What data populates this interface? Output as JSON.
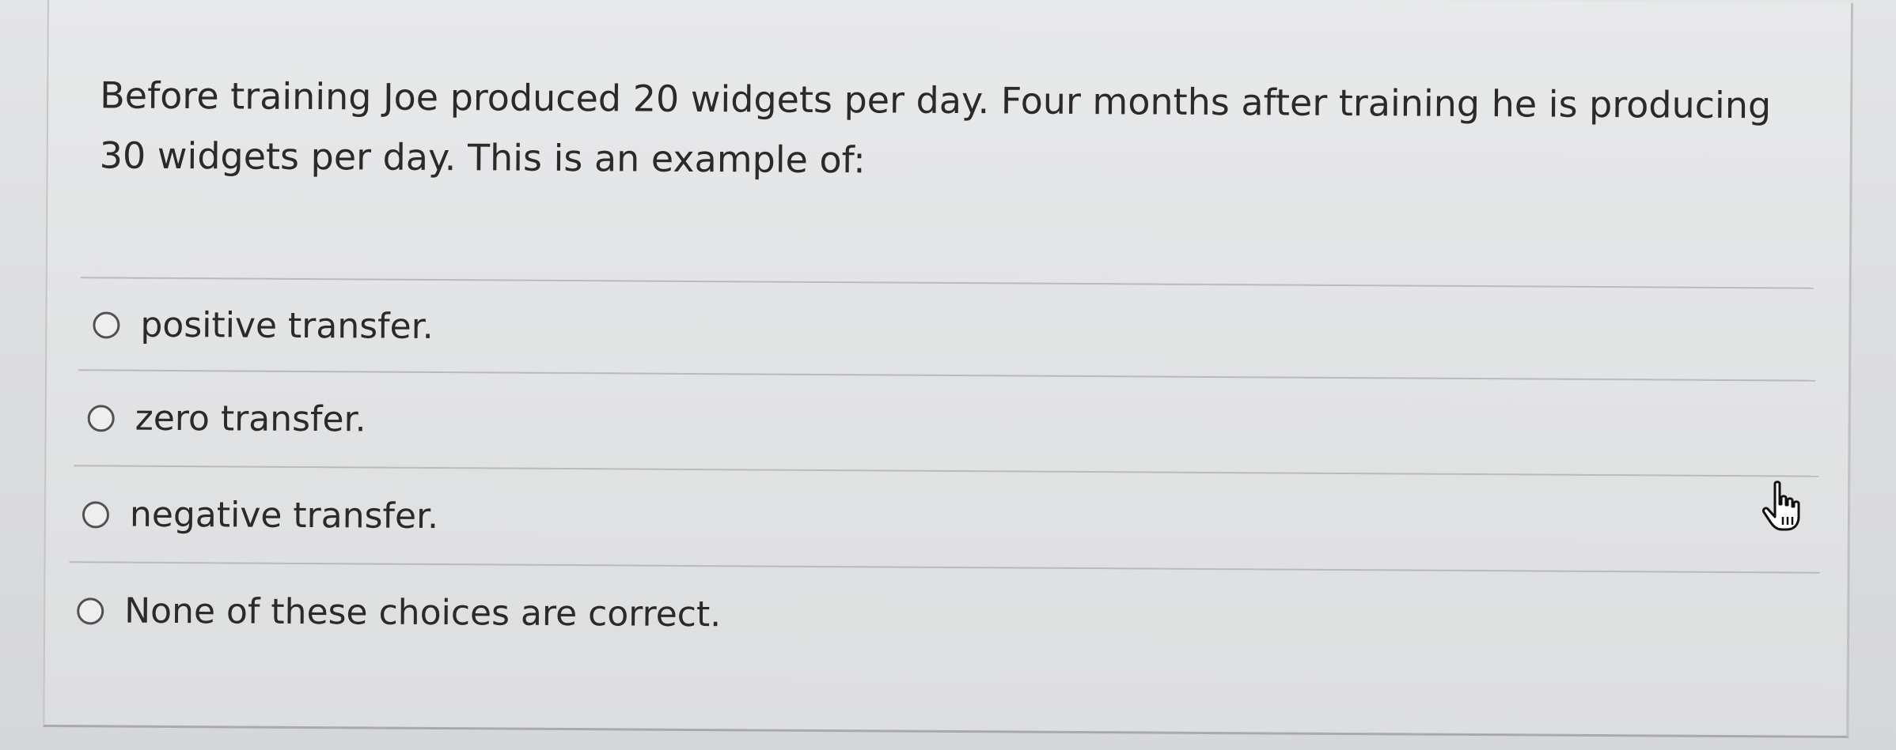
{
  "question": {
    "text": "Before training Joe produced 20 widgets per day. Four months after training he is producing 30 widgets per day. This is an example of:"
  },
  "options": [
    {
      "label": "positive transfer.",
      "selected": false
    },
    {
      "label": "zero transfer.",
      "selected": false
    },
    {
      "label": "negative transfer.",
      "selected": false
    },
    {
      "label": "None of these choices are correct.",
      "selected": false
    }
  ],
  "cursor": {
    "icon": "hand-pointer-icon"
  },
  "colors": {
    "background": "#d9dadb",
    "text": "#2a2a2b",
    "divider": "#b9babd",
    "radio_border": "#4f5154"
  }
}
